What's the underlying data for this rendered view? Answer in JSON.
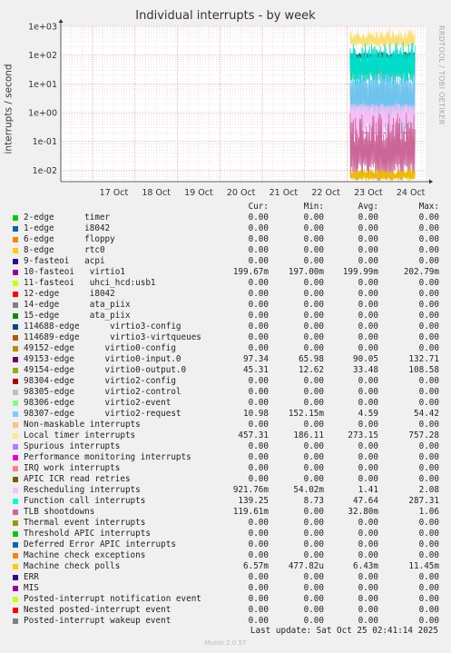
{
  "title": "Individual interrupts - by week",
  "watermark": "RRDTOOL / TOBI OETIKER",
  "footer": {
    "last_update": "Last update: Sat Oct 25 02:41:14 2025",
    "version": "Munin 2.0.57"
  },
  "legend_header": {
    "cur": "Cur:",
    "min": "Min:",
    "avg": "Avg:",
    "max": "Max:"
  },
  "chart_data": {
    "type": "line",
    "title": "Individual interrupts - by week",
    "ylabel": "interrupts / second",
    "yscale": "log",
    "ylim": [
      0.004,
      1000
    ],
    "yticks": [
      "1e-02",
      "1e-01",
      "1e+00",
      "1e+01",
      "1e+02",
      "1e+03"
    ],
    "yticks_values": [
      0.01,
      0.1,
      1,
      10,
      100,
      1000
    ],
    "xlim": [
      16.25,
      24.85
    ],
    "x_units": "day of October",
    "xticks": [
      "17 Oct",
      "18 Oct",
      "19 Oct",
      "20 Oct",
      "21 Oct",
      "22 Oct",
      "23 Oct",
      "24 Oct"
    ],
    "xticks_values": [
      17,
      18,
      19,
      20,
      21,
      22,
      23,
      24
    ],
    "data_start": 23.07,
    "data_end": 24.6,
    "grid": true,
    "series": [
      {
        "name": "10-fasteoi virtio1",
        "color": "#990099",
        "min": 0.197,
        "avg": 0.19999,
        "max": 0.2028,
        "cur": 0.19967
      },
      {
        "name": "49153-edge virtio0-input.0",
        "color": "#1a7a7a",
        "min": 65.98,
        "avg": 90.05,
        "max": 132.71,
        "cur": 97.34
      },
      {
        "name": "49154-edge virtio0-output.0",
        "color": "#0ccc66",
        "min": 12.62,
        "avg": 33.48,
        "max": 108.58,
        "cur": 45.31
      },
      {
        "name": "98307-edge virtio2-request",
        "color": "#6fc4ee",
        "min": 0.15215,
        "avg": 4.59,
        "max": 54.42,
        "cur": 10.98
      },
      {
        "name": "Local timer interrupts",
        "color": "#f8e076",
        "min": 186.11,
        "avg": 273.15,
        "max": 757.28,
        "cur": 457.31
      },
      {
        "name": "Rescheduling interrupts",
        "color": "#f5bff5",
        "min": 0.05402,
        "avg": 1.41,
        "max": 2.08,
        "cur": 0.92176
      },
      {
        "name": "Function call interrupts",
        "color": "#00ddcc",
        "min": 8.73,
        "avg": 47.64,
        "max": 287.31,
        "cur": 139.25
      },
      {
        "name": "TLB shootdowns",
        "color": "#cc6699",
        "min": 0,
        "avg": 0.0328,
        "max": 1.06,
        "cur": 0.11961
      },
      {
        "name": "Machine check polls",
        "color": "#eebb00",
        "min": 0.00047782,
        "avg": 0.00643,
        "max": 0.01145,
        "cur": 0.00657
      }
    ]
  },
  "legend": [
    {
      "name": "2-edge      timer",
      "color": "#00cc00",
      "cur": "0.00",
      "min": "0.00",
      "avg": "0.00",
      "max": "0.00"
    },
    {
      "name": "1-edge      i8042",
      "color": "#0066b3",
      "cur": "0.00",
      "min": "0.00",
      "avg": "0.00",
      "max": "0.00"
    },
    {
      "name": "6-edge      floppy",
      "color": "#ff8000",
      "cur": "0.00",
      "min": "0.00",
      "avg": "0.00",
      "max": "0.00"
    },
    {
      "name": "8-edge      rtc0",
      "color": "#ffcc00",
      "cur": "0.00",
      "min": "0.00",
      "avg": "0.00",
      "max": "0.00"
    },
    {
      "name": "9-fasteoi   acpi",
      "color": "#330099",
      "cur": "0.00",
      "min": "0.00",
      "avg": "0.00",
      "max": "0.00"
    },
    {
      "name": "10-fasteoi   virtio1",
      "color": "#990099",
      "cur": "199.67m",
      "min": "197.00m",
      "avg": "199.99m",
      "max": "202.79m"
    },
    {
      "name": "11-fasteoi   uhci_hcd:usb1",
      "color": "#ccff00",
      "cur": "0.00",
      "min": "0.00",
      "avg": "0.00",
      "max": "0.00"
    },
    {
      "name": "12-edge      i8042",
      "color": "#ff0000",
      "cur": "0.00",
      "min": "0.00",
      "avg": "0.00",
      "max": "0.00"
    },
    {
      "name": "14-edge      ata_piix",
      "color": "#808080",
      "cur": "0.00",
      "min": "0.00",
      "avg": "0.00",
      "max": "0.00"
    },
    {
      "name": "15-edge      ata_piix",
      "color": "#008f00",
      "cur": "0.00",
      "min": "0.00",
      "avg": "0.00",
      "max": "0.00"
    },
    {
      "name": "114688-edge      virtio3-config",
      "color": "#00487d",
      "cur": "0.00",
      "min": "0.00",
      "avg": "0.00",
      "max": "0.00"
    },
    {
      "name": "114689-edge      virtio3-virtqueues",
      "color": "#b35a00",
      "cur": "0.00",
      "min": "0.00",
      "avg": "0.00",
      "max": "0.00"
    },
    {
      "name": "49152-edge      virtio0-config",
      "color": "#b38f00",
      "cur": "0.00",
      "min": "0.00",
      "avg": "0.00",
      "max": "0.00"
    },
    {
      "name": "49153-edge      virtio0-input.0",
      "color": "#6b006b",
      "cur": "97.34",
      "min": "65.98",
      "avg": "90.05",
      "max": "132.71"
    },
    {
      "name": "49154-edge      virtio0-output.0",
      "color": "#8fb300",
      "cur": "45.31",
      "min": "12.62",
      "avg": "33.48",
      "max": "108.58"
    },
    {
      "name": "98304-edge      virtio2-config",
      "color": "#b30000",
      "cur": "0.00",
      "min": "0.00",
      "avg": "0.00",
      "max": "0.00"
    },
    {
      "name": "98305-edge      virtio2-control",
      "color": "#bebebe",
      "cur": "0.00",
      "min": "0.00",
      "avg": "0.00",
      "max": "0.00"
    },
    {
      "name": "98306-edge      virtio2-event",
      "color": "#80ff80",
      "cur": "0.00",
      "min": "0.00",
      "avg": "0.00",
      "max": "0.00"
    },
    {
      "name": "98307-edge      virtio2-request",
      "color": "#80c9ff",
      "cur": "10.98",
      "min": "152.15m",
      "avg": "4.59",
      "max": "54.42"
    },
    {
      "name": "Non-maskable interrupts",
      "color": "#ffc080",
      "cur": "0.00",
      "min": "0.00",
      "avg": "0.00",
      "max": "0.00"
    },
    {
      "name": "Local timer interrupts",
      "color": "#ffe680",
      "cur": "457.31",
      "min": "186.11",
      "avg": "273.15",
      "max": "757.28"
    },
    {
      "name": "Spurious interrupts",
      "color": "#aa80ff",
      "cur": "0.00",
      "min": "0.00",
      "avg": "0.00",
      "max": "0.00"
    },
    {
      "name": "Performance monitoring interrupts",
      "color": "#ee00cc",
      "cur": "0.00",
      "min": "0.00",
      "avg": "0.00",
      "max": "0.00"
    },
    {
      "name": "IRQ work interrupts",
      "color": "#ff8080",
      "cur": "0.00",
      "min": "0.00",
      "avg": "0.00",
      "max": "0.00"
    },
    {
      "name": "APIC ICR read retries",
      "color": "#666600",
      "cur": "0.00",
      "min": "0.00",
      "avg": "0.00",
      "max": "0.00"
    },
    {
      "name": "Rescheduling interrupts",
      "color": "#ffbfff",
      "cur": "921.76m",
      "min": "54.02m",
      "avg": "1.41",
      "max": "2.08"
    },
    {
      "name": "Function call interrupts",
      "color": "#00ffcc",
      "cur": "139.25",
      "min": "8.73",
      "avg": "47.64",
      "max": "287.31"
    },
    {
      "name": "TLB shootdowns",
      "color": "#cc6699",
      "cur": "119.61m",
      "min": "0.00",
      "avg": "32.80m",
      "max": "1.06"
    },
    {
      "name": "Thermal event interrupts",
      "color": "#999900",
      "cur": "0.00",
      "min": "0.00",
      "avg": "0.00",
      "max": "0.00"
    },
    {
      "name": "Threshold APIC interrupts",
      "color": "#00cc00",
      "cur": "0.00",
      "min": "0.00",
      "avg": "0.00",
      "max": "0.00"
    },
    {
      "name": "Deferred Error APIC interrupts",
      "color": "#0066b3",
      "cur": "0.00",
      "min": "0.00",
      "avg": "0.00",
      "max": "0.00"
    },
    {
      "name": "Machine check exceptions",
      "color": "#ff8000",
      "cur": "0.00",
      "min": "0.00",
      "avg": "0.00",
      "max": "0.00"
    },
    {
      "name": "Machine check polls",
      "color": "#ffcc00",
      "cur": "6.57m",
      "min": "477.82u",
      "avg": "6.43m",
      "max": "11.45m"
    },
    {
      "name": "ERR",
      "color": "#330099",
      "cur": "0.00",
      "min": "0.00",
      "avg": "0.00",
      "max": "0.00"
    },
    {
      "name": "MIS",
      "color": "#990099",
      "cur": "0.00",
      "min": "0.00",
      "avg": "0.00",
      "max": "0.00"
    },
    {
      "name": "Posted-interrupt notification event",
      "color": "#ccff00",
      "cur": "0.00",
      "min": "0.00",
      "avg": "0.00",
      "max": "0.00"
    },
    {
      "name": "Nested posted-interrupt event",
      "color": "#ff0000",
      "cur": "0.00",
      "min": "0.00",
      "avg": "0.00",
      "max": "0.00"
    },
    {
      "name": "Posted-interrupt wakeup event",
      "color": "#808080",
      "cur": "0.00",
      "min": "0.00",
      "avg": "0.00",
      "max": "0.00"
    }
  ]
}
